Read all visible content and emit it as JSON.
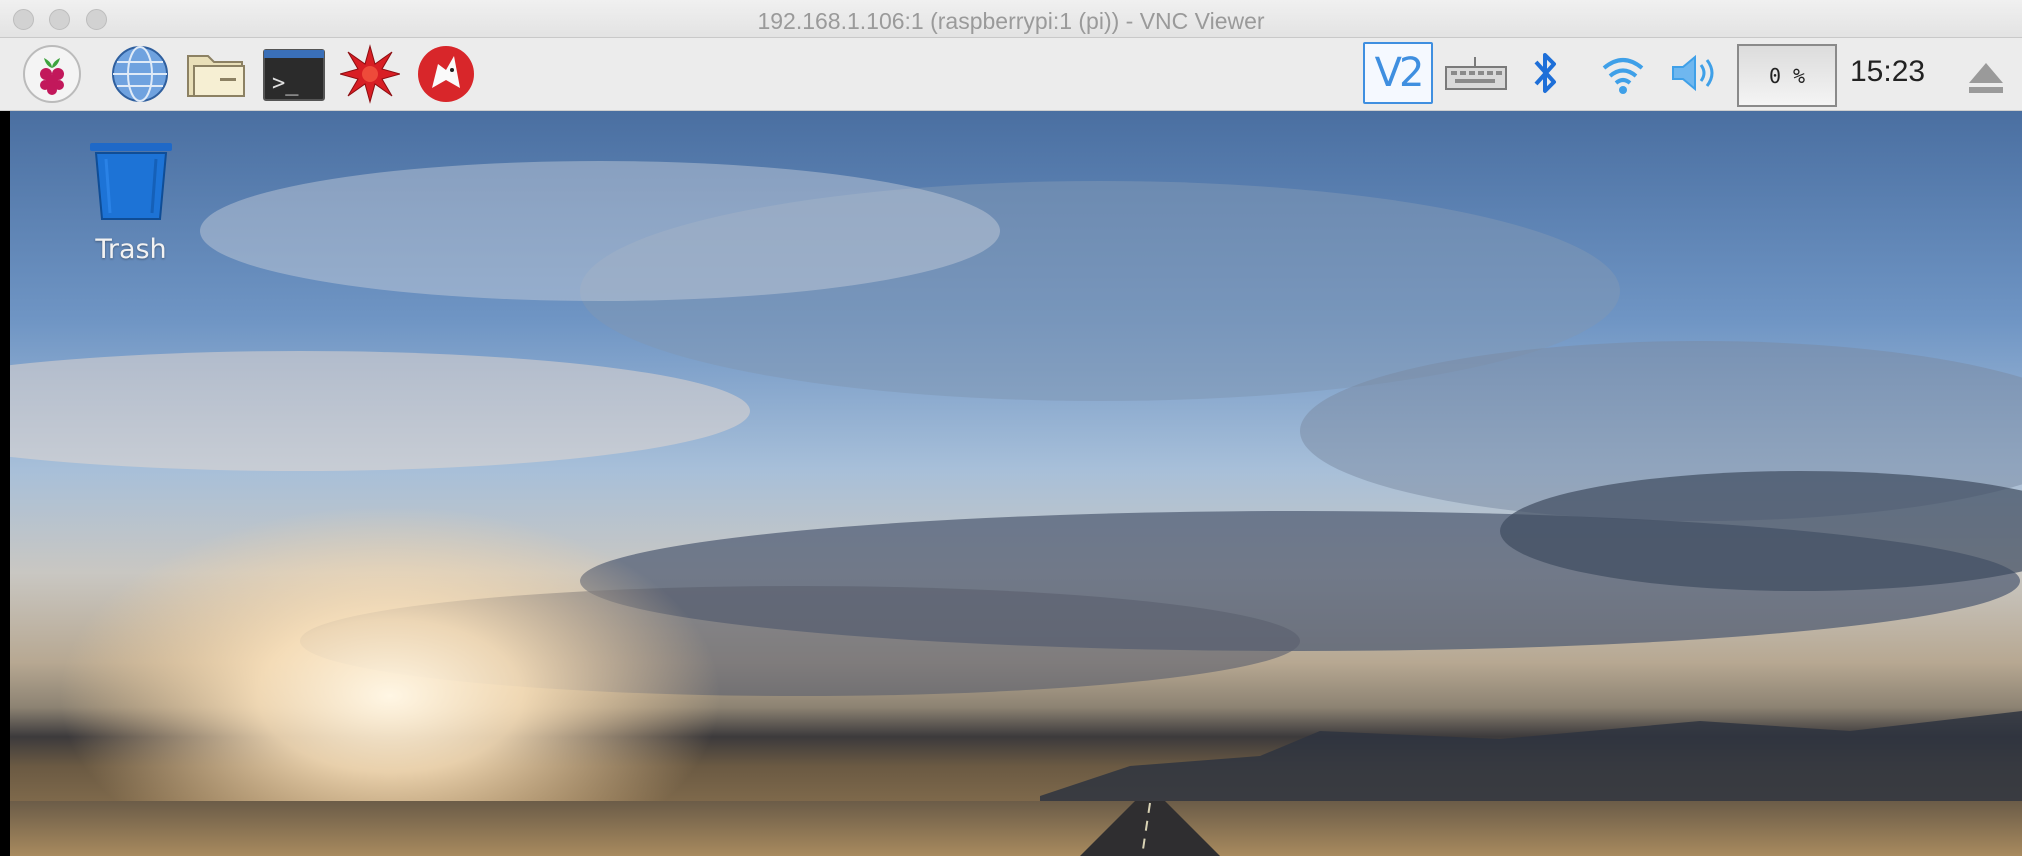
{
  "window": {
    "title": "192.168.1.106:1 (raspberrypi:1 (pi)) - VNC Viewer"
  },
  "panel": {
    "launchers": [
      {
        "icon": "raspberry-menu-icon"
      },
      {
        "icon": "web-browser-globe-icon"
      },
      {
        "icon": "file-manager-folder-icon"
      },
      {
        "icon": "terminal-icon"
      },
      {
        "icon": "mathematica-icon"
      },
      {
        "icon": "wolfram-icon"
      }
    ],
    "tray": {
      "vnc_label": "V2",
      "cpu_usage": "0 %",
      "clock": "15:23"
    }
  },
  "desktop": {
    "icons": [
      {
        "label": "Trash",
        "icon": "trash-icon"
      }
    ]
  },
  "colors": {
    "vnc_accent": "#3f8fe0",
    "bluetooth": "#1e6fd8",
    "wifi": "#3fa0e8",
    "volume": "#3fa0e8"
  }
}
